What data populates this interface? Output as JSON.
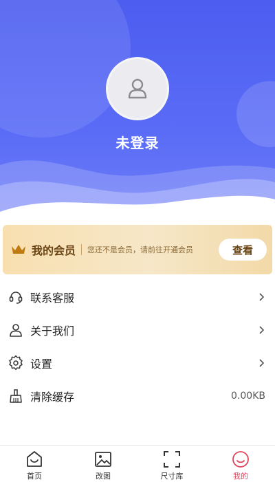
{
  "profile": {
    "name": "未登录"
  },
  "member": {
    "title": "我的会员",
    "subtitle": "您还不是会员，请前往开通会员",
    "button": "查看"
  },
  "menu": [
    {
      "label": "联系客服",
      "icon": "headset-icon",
      "value": ""
    },
    {
      "label": "关于我们",
      "icon": "user-icon",
      "value": ""
    },
    {
      "label": "设置",
      "icon": "gear-icon",
      "value": ""
    },
    {
      "label": "清除缓存",
      "icon": "broom-icon",
      "value": "0.00KB"
    }
  ],
  "tabs": [
    {
      "label": "首页",
      "icon": "home-icon"
    },
    {
      "label": "改图",
      "icon": "image-icon"
    },
    {
      "label": "尺寸库",
      "icon": "frame-icon"
    },
    {
      "label": "我的",
      "icon": "smile-icon"
    }
  ],
  "colors": {
    "header": "#5a6cf6",
    "member_gold": "#f6e7c8",
    "active_tab": "#e0445a"
  }
}
